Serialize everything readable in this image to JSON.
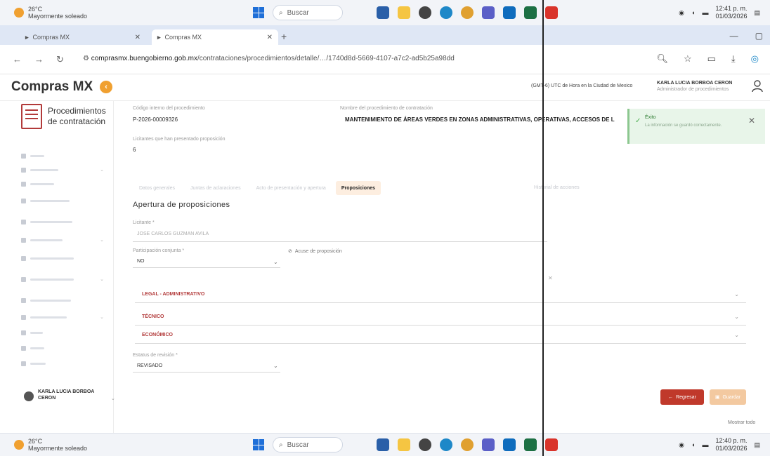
{
  "taskbar_top": {
    "weather_temp": "26°C",
    "weather_desc": "Mayormente soleado",
    "search": "Buscar",
    "time": "12:41 p. m.",
    "date": "01/03/2026"
  },
  "taskbar_bottom": {
    "weather_temp": "26°C",
    "weather_desc": "Mayormente soleado",
    "search": "Buscar",
    "time": "12:40 p. m.",
    "date": "01/03/2026"
  },
  "browser": {
    "tabs": [
      {
        "label": "Compras MX"
      },
      {
        "label": "Compras MX"
      }
    ],
    "url_domain": "comprasmx.buengobierno.gob.mx",
    "url_path": "/contrataciones/procedimientos/detalle/…/1740d8d-5669-4107-a7c2-ad5b25a98dd"
  },
  "header": {
    "brand": "Compras MX",
    "timezone": "(GMT-6) UTC de Hora en la Ciudad de Mexico",
    "user_name": "KARLA LUCIA BORBOA CERON",
    "user_role": "Administrador de procedimientos"
  },
  "sidebar": {
    "title_line1": "Procedimientos",
    "title_line2": "de contratación",
    "items": [
      {
        "w": 20
      },
      {
        "w": 40
      },
      {
        "w": 34
      },
      {
        "w": 56
      },
      {
        "w": 60
      },
      {
        "w": 46
      },
      {
        "w": 62
      },
      {
        "w": 62
      },
      {
        "w": 58
      },
      {
        "w": 52
      },
      {
        "w": 18
      },
      {
        "w": 20
      },
      {
        "w": 22
      }
    ],
    "user_name": "KARLA LUCIA BORBOA CERON"
  },
  "main": {
    "codigo_label": "Código interno del procedimiento",
    "codigo_value": "P-2026-00009326",
    "nombre_label": "Nombre del procedimiento de contratación",
    "nombre_value": "MANTENIMIENTO DE ÁREAS VERDES EN ZONAS ADMINISTRATIVAS, OPERATIVAS, ACCESOS DE L",
    "licitantes_label": "Licitantes que han presentado proposición",
    "licitantes_value": "6",
    "tabs": [
      {
        "label": "Datos generales"
      },
      {
        "label": "Juntas de aclaraciones"
      },
      {
        "label": "Acto de presentación y apertura"
      },
      {
        "label": "Proposiciones"
      }
    ],
    "historial_link": "Historial de acciones",
    "section_title": "Apertura de proposiciones",
    "licitante_label": "Licitante *",
    "licitante_value": "JOSE CARLOS GUZMAN AVILA",
    "participacion_label": "Participación conjunta *",
    "participacion_value": "NO",
    "acuse_label": "Acuse de proposición",
    "panels": [
      {
        "label": "LEGAL - ADMINISTRATIVO"
      },
      {
        "label": "TÉCNICO"
      },
      {
        "label": "ECONÓMICO"
      }
    ],
    "estatus_label": "Estatus de revisión *",
    "estatus_value": "REVISADO",
    "btn_regresar": "Regresar",
    "btn_guardar": "Guardar",
    "show_more": "Mostrar todo"
  },
  "toast": {
    "title": "Éxito",
    "message": "La información se guardó correctamente."
  }
}
